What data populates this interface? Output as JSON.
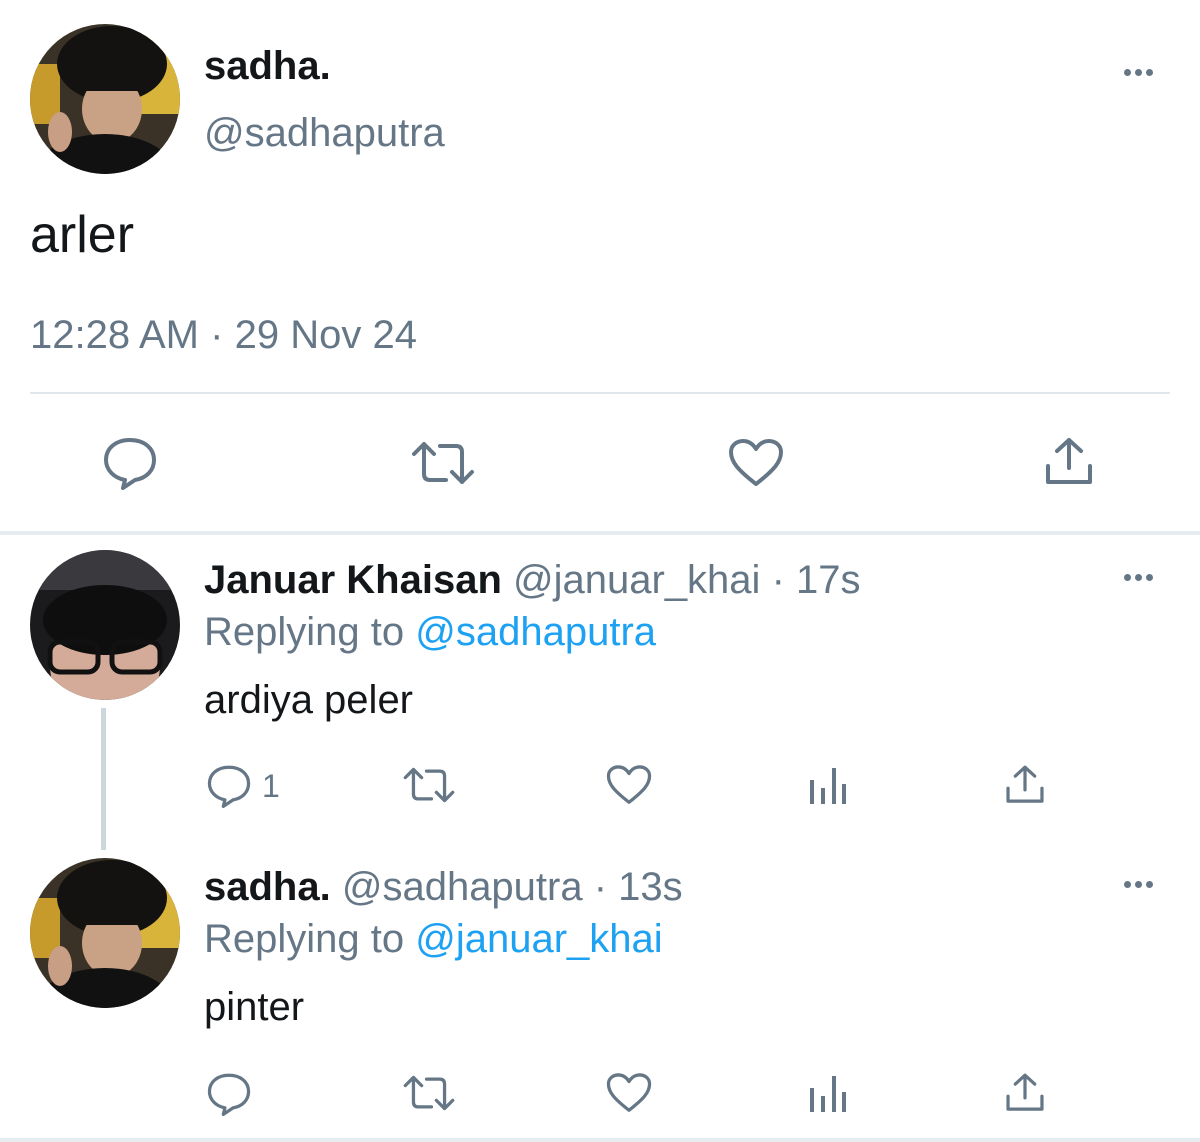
{
  "main_tweet": {
    "display_name": "sadha.",
    "handle": "@sadhaputra",
    "text": "arler",
    "time": "12:28 AM",
    "separator": "·",
    "date": "29 Nov 24"
  },
  "replies": [
    {
      "display_name": "Januar Khaisan",
      "handle": "@januar_khai",
      "age": "· 17s",
      "replying_prefix": "Replying to",
      "replying_to": "@sadhaputra",
      "text": "ardiya peler",
      "reply_count": "1"
    },
    {
      "display_name": "sadha.",
      "handle": "@sadhaputra",
      "age": "· 13s",
      "replying_prefix": "Replying to",
      "replying_to": "@januar_khai",
      "text": "pinter",
      "reply_count": ""
    }
  ],
  "icons": [
    "reply-icon",
    "retweet-icon",
    "like-icon",
    "analytics-icon",
    "share-icon",
    "more-icon"
  ],
  "colors": {
    "text": "#14171a",
    "secondary": "#657786",
    "link": "#1da1f2",
    "divider": "#e1e8ed"
  }
}
